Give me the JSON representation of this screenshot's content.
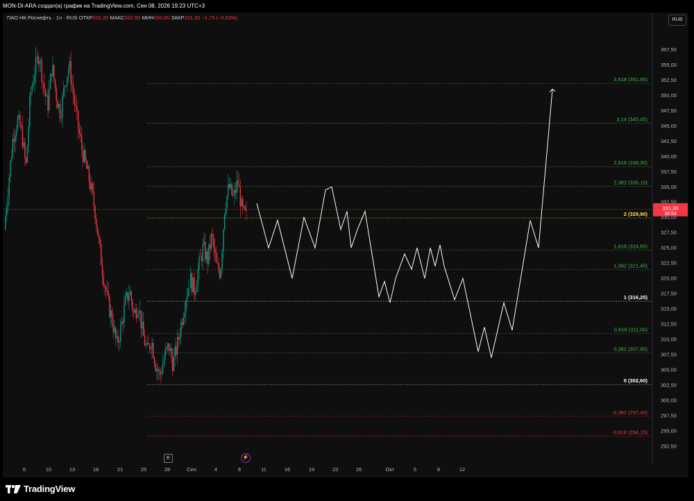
{
  "header": {
    "author_line": "MON-DI-ARA создал(а) график на TradingView.com, Сен 08, 2026 19:23 UTC+3"
  },
  "legend": {
    "symbol": "ПАО НК Роснефть · 1ч · RUS",
    "open_label": "ОТКР",
    "open": "332,35",
    "high_label": "МАКС",
    "high": "332,55",
    "low_label": "МИН",
    "low": "330,80",
    "close_label": "ЗАКР",
    "close": "331,30",
    "change": "−1,75 (−0,53%)"
  },
  "currency": "RUB",
  "brand": "TradingView",
  "markers": {
    "earnings": "E",
    "dividend_icon": "lightning-icon"
  },
  "colors": {
    "up": "#089981",
    "down": "#f23645",
    "projection": "#ffffff",
    "last_price": "#f23645",
    "fib_green": "#4caf50",
    "fib_red": "#f23645",
    "fib_yellow": "#ffeb3b",
    "fib_white": "#ffffff"
  },
  "chart_data": {
    "type": "candlestick",
    "timeframe": "1ч",
    "ylim": [
      290.0,
      360.5
    ],
    "y_ticks": [
      "357,50",
      "355,00",
      "352,50",
      "350,00",
      "347,50",
      "345,00",
      "342,50",
      "340,00",
      "337,50",
      "335,00",
      "332,50",
      "330,00",
      "327,50",
      "325,00",
      "322,50",
      "320,00",
      "317,50",
      "315,00",
      "312,50",
      "310,00",
      "307,50",
      "305,00",
      "302,50",
      "300,00",
      "297,50",
      "295,00",
      "292,50"
    ],
    "x_ticks": [
      "6",
      "10",
      "13",
      "18",
      "21",
      "25",
      "28",
      "Сен",
      "4",
      "8",
      "11",
      "16",
      "19",
      "23",
      "26",
      "Окт",
      "5",
      "8",
      "12"
    ],
    "last_price": {
      "value": "331,30",
      "countdown": "36:54"
    },
    "price_path": [
      [
        0,
        328
      ],
      [
        2,
        336
      ],
      [
        4,
        343
      ],
      [
        6,
        346
      ],
      [
        8,
        344
      ],
      [
        10,
        338
      ],
      [
        12,
        350
      ],
      [
        14,
        354
      ],
      [
        16,
        357
      ],
      [
        18,
        352
      ],
      [
        20,
        348
      ],
      [
        22,
        355
      ],
      [
        24,
        350
      ],
      [
        26,
        347
      ],
      [
        28,
        352
      ],
      [
        30,
        355
      ],
      [
        32,
        350
      ],
      [
        34,
        345
      ],
      [
        36,
        341
      ],
      [
        38,
        338
      ],
      [
        40,
        335
      ],
      [
        42,
        331
      ],
      [
        44,
        325
      ],
      [
        46,
        320
      ],
      [
        48,
        316
      ],
      [
        50,
        313
      ],
      [
        52,
        309
      ],
      [
        54,
        312
      ],
      [
        56,
        316
      ],
      [
        58,
        318
      ],
      [
        60,
        314
      ],
      [
        62,
        316
      ],
      [
        64,
        311
      ],
      [
        66,
        308
      ],
      [
        68,
        310
      ],
      [
        70,
        306
      ],
      [
        72,
        304
      ],
      [
        74,
        307
      ],
      [
        76,
        309
      ],
      [
        78,
        306
      ],
      [
        80,
        309
      ],
      [
        82,
        313
      ],
      [
        84,
        317
      ],
      [
        86,
        320
      ],
      [
        88,
        318
      ],
      [
        90,
        322
      ],
      [
        92,
        325
      ],
      [
        94,
        323
      ],
      [
        96,
        327
      ],
      [
        98,
        322
      ],
      [
        100,
        321
      ],
      [
        102,
        332
      ],
      [
        104,
        335
      ],
      [
        106,
        333
      ],
      [
        108,
        336
      ],
      [
        110,
        331
      ],
      [
        112,
        330
      ]
    ],
    "projection": [
      {
        "time": "8",
        "value": 332.3
      },
      {
        "value": 325.0
      },
      {
        "value": 329.5
      },
      {
        "value": 320.0
      },
      {
        "value": 330.0
      },
      {
        "value": 325.0
      },
      {
        "value": 334.5
      },
      {
        "value": 335.0
      },
      {
        "value": 328.0
      },
      {
        "value": 331.0
      },
      {
        "value": 325.0
      },
      {
        "value": 328.0
      },
      {
        "value": 331.0
      },
      {
        "value": 317.0
      },
      {
        "value": 319.5
      },
      {
        "value": 316.0
      },
      {
        "value": 320.0
      },
      {
        "value": 324.0
      },
      {
        "value": 321.5
      },
      {
        "value": 325.0
      },
      {
        "value": 320.0
      },
      {
        "value": 325.0
      },
      {
        "value": 322.0
      },
      {
        "value": 325.5
      },
      {
        "value": 322.0
      },
      {
        "value": 316.5
      },
      {
        "value": 320.0
      },
      {
        "value": 308.0
      },
      {
        "value": 312.0
      },
      {
        "value": 307.0
      },
      {
        "value": 316.0
      },
      {
        "value": 311.5
      },
      {
        "value": 329.5
      },
      {
        "value": 325.0
      },
      {
        "value": 351.0
      }
    ],
    "fib_levels": [
      {
        "label": "3,618 (351,95)",
        "value": 351.95,
        "color": "#4caf50",
        "bold": false
      },
      {
        "label": "3,14 (345,45)",
        "value": 345.45,
        "color": "#4caf50",
        "bold": false
      },
      {
        "label": "2,618 (338,30)",
        "value": 338.3,
        "color": "#4caf50",
        "bold": false
      },
      {
        "label": "2,382 (335,10)",
        "value": 335.1,
        "color": "#4caf50",
        "bold": false
      },
      {
        "label": "2 (329,90)",
        "value": 329.9,
        "color": "#ffeb3b",
        "bold": true
      },
      {
        "label": "1,618 (324,65)",
        "value": 324.65,
        "color": "#4caf50",
        "bold": false
      },
      {
        "label": "1,382 (321,45)",
        "value": 321.45,
        "color": "#4caf50",
        "bold": false
      },
      {
        "label": "1 (316,25)",
        "value": 316.25,
        "color": "#ffffff",
        "bold": true
      },
      {
        "label": "0,618 (311,00)",
        "value": 311.0,
        "color": "#4caf50",
        "bold": false
      },
      {
        "label": "0,382 (307,80)",
        "value": 307.8,
        "color": "#4caf50",
        "bold": false
      },
      {
        "label": "0 (302,60)",
        "value": 302.6,
        "color": "#ffffff",
        "bold": true
      },
      {
        "label": "-0,382 (297,40)",
        "value": 297.4,
        "color": "#f23645",
        "bold": false
      },
      {
        "label": "-0,618 (294,15)",
        "value": 294.15,
        "color": "#f23645",
        "bold": false
      }
    ]
  }
}
